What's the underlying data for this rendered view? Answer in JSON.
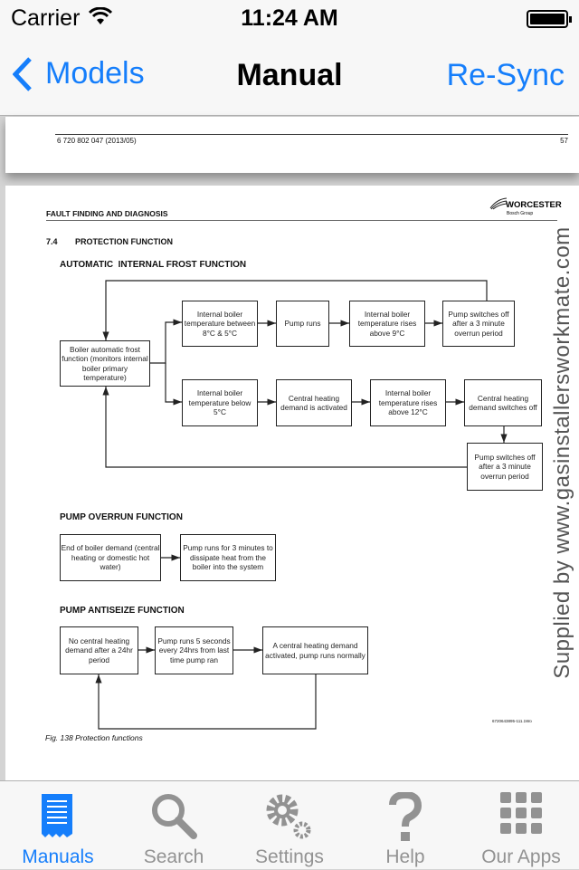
{
  "status_bar": {
    "carrier": "Carrier",
    "time": "11:24 AM"
  },
  "nav": {
    "back_label": "Models",
    "title": "Manual",
    "right_label": "Re-Sync"
  },
  "previous_page": {
    "doc_code": "6 720 802 047 (2013/05)",
    "page_number": "57"
  },
  "page": {
    "section_header": "FAULT FINDING AND DIAGNOSIS",
    "logo": {
      "brand": "WORCESTER",
      "sub": "Bosch Group"
    },
    "section_number": "7.4",
    "section_title": "PROTECTION FUNCTION",
    "frost": {
      "title": "AUTOMATIC  INTERNAL FROST FUNCTION",
      "start": "Boiler automatic frost function (monitors internal boiler primary temperature)",
      "top_row": [
        "Internal boiler temperature between 8°C & 5°C",
        "Pump runs",
        "Internal boiler temperature rises above 9°C",
        "Pump switches off after a 3 minute overrun period"
      ],
      "bottom_row": [
        "Internal boiler temperature below 5°C",
        "Central heating demand is activated",
        "Internal boiler temperature rises above 12°C",
        "Central heating demand switches off"
      ],
      "final": "Pump switches off after a 3 minute overrun period"
    },
    "overrun": {
      "title": "PUMP OVERRUN FUNCTION",
      "steps": [
        "End of boiler demand (central heating or domestic hot water)",
        "Pump runs for 3 minutes to dissipate heat from the boiler into the system"
      ]
    },
    "antiseize": {
      "title": "PUMP ANTISEIZE FUNCTION",
      "steps": [
        "No central heating demand after a 24hr period",
        "Pump runs 5 seconds every 24hrs from last time pump ran",
        "A central heating demand activated, pump runs normally"
      ]
    },
    "figure_code": "6720643895-111.1Wo",
    "caption": "Fig. 138  Protection functions",
    "watermark": "Supplied by www.gasinstallersworkmate.com"
  },
  "tabs": [
    {
      "label": "Manuals",
      "icon": "document-icon",
      "active": true
    },
    {
      "label": "Search",
      "icon": "magnifier-icon"
    },
    {
      "label": "Settings",
      "icon": "gear-icon"
    },
    {
      "label": "Help",
      "icon": "question-icon"
    },
    {
      "label": "Our Apps",
      "icon": "grid-icon"
    }
  ],
  "colors": {
    "accent": "#157efb",
    "tab_inactive": "#929292"
  }
}
